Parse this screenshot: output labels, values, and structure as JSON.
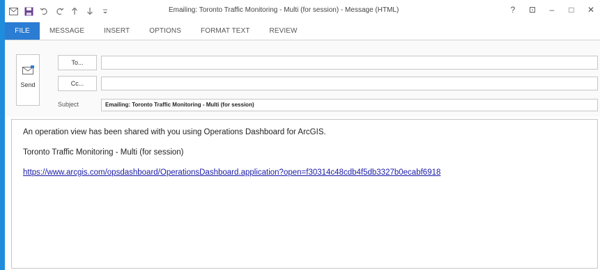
{
  "quick_access": {
    "icons": [
      "mail-icon",
      "save-icon",
      "undo-icon",
      "redo-icon",
      "arrow-up-icon",
      "arrow-down-icon",
      "customize-icon"
    ]
  },
  "window": {
    "title": "Emailing: Toronto Traffic Monitoring - Multi (for session) - Message (HTML)",
    "controls": {
      "help": "?",
      "ribbon_options": "⊡",
      "minimize": "–",
      "maximize": "□",
      "close": "✕"
    }
  },
  "ribbon": {
    "tabs": [
      "FILE",
      "MESSAGE",
      "INSERT",
      "OPTIONS",
      "FORMAT TEXT",
      "REVIEW"
    ]
  },
  "header": {
    "send_label": "Send",
    "to_button": "To...",
    "cc_button": "Cc...",
    "to_value": "",
    "cc_value": "",
    "subject_label": "Subject",
    "subject_value": "Emailing: Toronto Traffic Monitoring - Multi (for session)"
  },
  "body": {
    "line1": "An operation view has been shared with you using Operations Dashboard for ArcGIS.",
    "line2": "Toronto Traffic Monitoring - Multi (for session)",
    "link": "https://www.arcgis.com/opsdashboard/OperationsDashboard.application?open=f30314c48cdb4f5db3327b0ecabf6918"
  },
  "colors": {
    "accent": "#2b7cd3",
    "window_edge": "#1f8ddc",
    "link": "#1a1aa6"
  }
}
